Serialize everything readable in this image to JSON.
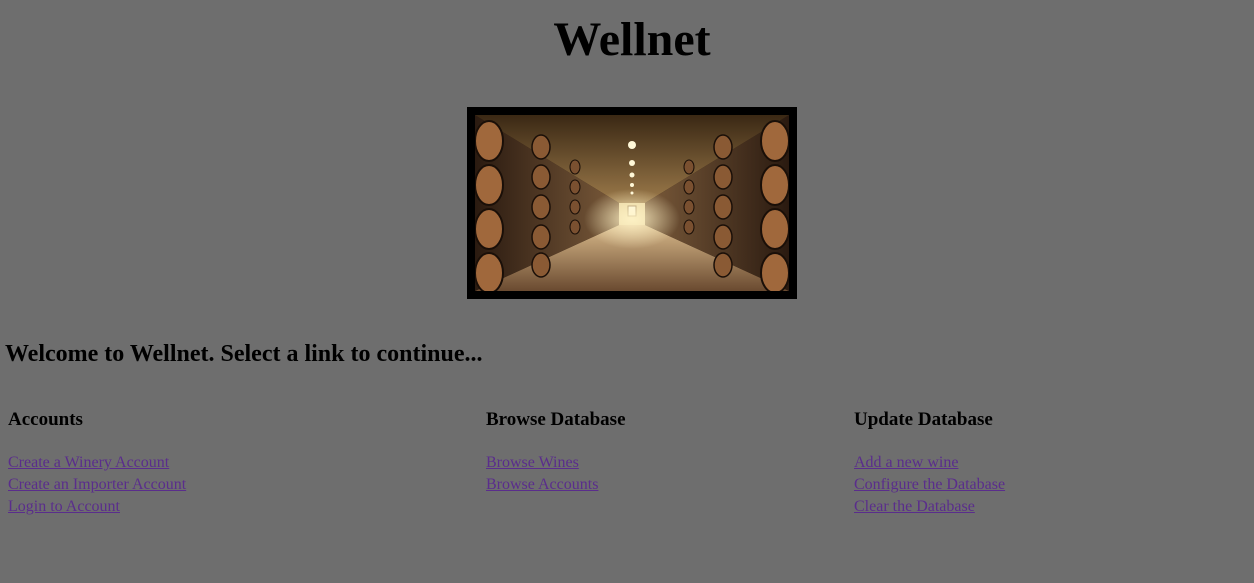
{
  "site": {
    "title": "Wellnet"
  },
  "banner": {
    "image_name": "wine-cellar-barrels-image"
  },
  "welcome_text": "Welcome to Wellnet. Select a link to continue...",
  "sections": {
    "accounts": {
      "heading": "Accounts",
      "links": [
        "Create a Winery Account",
        "Create an Importer Account",
        "Login to Account"
      ]
    },
    "browse": {
      "heading": "Browse Database",
      "links": [
        "Browse Wines",
        "Browse Accounts"
      ]
    },
    "update": {
      "heading": "Update Database",
      "links": [
        "Add a new wine",
        "Configure the Database",
        "Clear the Database"
      ]
    }
  },
  "colors": {
    "background": "#6e6e6e",
    "link": "#5a2d8c",
    "frame": "#000000"
  }
}
